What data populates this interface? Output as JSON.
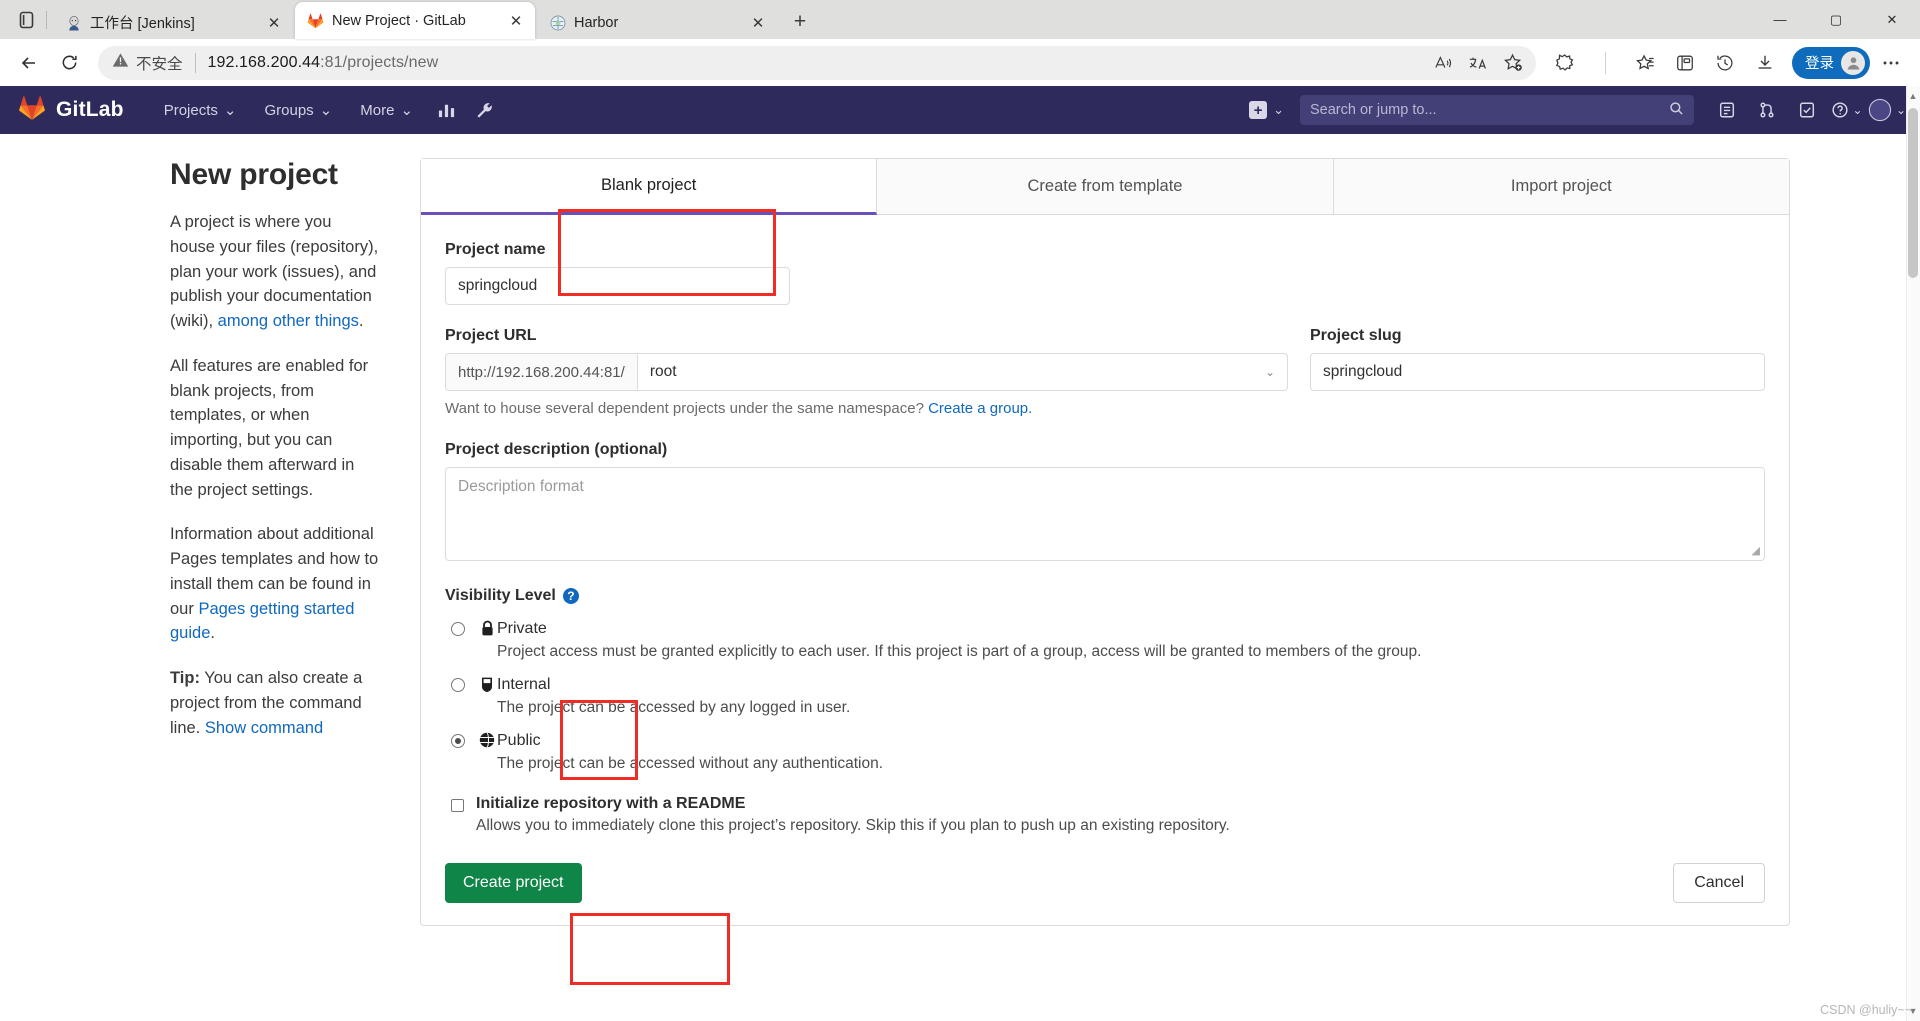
{
  "browser": {
    "tabs": [
      {
        "title": "工作台 [Jenkins]",
        "favicon": "jenkins-icon",
        "active": false
      },
      {
        "title": "New Project · GitLab",
        "favicon": "gitlab-icon",
        "active": true
      },
      {
        "title": "Harbor",
        "favicon": "harbor-icon",
        "active": false
      }
    ],
    "new_tab_label": "+",
    "tab_close_label": "✕",
    "window_controls": {
      "minimize": "—",
      "maximize": "▢",
      "close": "✕"
    },
    "toolbar": {
      "back_icon": "back-arrow-icon",
      "refresh_icon": "refresh-icon",
      "security_label": "不安全",
      "url_host": "192.168.200.44",
      "url_path": ":81/projects/new",
      "read_aloud_icon": "read-aloud-icon",
      "translate_icon": "translate-icon",
      "favorite_icon": "add-favorite-icon",
      "collections_icon": "collections-icon",
      "split_icon": "split-screen-icon",
      "history_icon": "history-icon",
      "downloads_icon": "downloads-icon",
      "settings_icon": "more-settings-icon",
      "signin_label": "登录"
    }
  },
  "gitlab": {
    "brand": "GitLab",
    "nav_links": [
      {
        "label": "Projects",
        "caret": "⌄"
      },
      {
        "label": "Groups",
        "caret": "⌄"
      },
      {
        "label": "More",
        "caret": "⌄"
      }
    ],
    "nav_icons": [
      "analytics-icon",
      "wrench-icon"
    ],
    "new_menu": {
      "plus": "+",
      "caret": "⌄"
    },
    "search": {
      "placeholder": "Search or jump to...",
      "icon": "search-icon"
    },
    "right_icons": [
      "issues-icon",
      "merge-requests-icon",
      "todos-icon",
      "help-icon",
      "avatar"
    ]
  },
  "sidebar": {
    "title": "New project",
    "paragraph1_pre": "A project is where you house your files (repository), plan your work (issues), and publish your documentation (wiki), ",
    "paragraph1_link": "among other things",
    "paragraph1_post": ".",
    "paragraph2": "All features are enabled for blank projects, from templates, or when importing, but you can disable them afterward in the project settings.",
    "paragraph3_pre": "Information about additional Pages templates and how to install them can be found in our ",
    "paragraph3_link": "Pages getting started guide",
    "paragraph3_post": ".",
    "tip_label": "Tip:",
    "tip_text": " You can also create a project from the command line. ",
    "tip_link": "Show command"
  },
  "form": {
    "tabs": [
      {
        "label": "Blank project",
        "active": true
      },
      {
        "label": "Create from template",
        "active": false
      },
      {
        "label": "Import project",
        "active": false
      }
    ],
    "project_name": {
      "label": "Project name",
      "value": "springcloud",
      "placeholder": ""
    },
    "project_url": {
      "label": "Project URL",
      "prefix": "http://192.168.200.44:81/",
      "namespace": "root",
      "caret": "⌄"
    },
    "project_slug": {
      "label": "Project slug",
      "value": "springcloud"
    },
    "namespace_hint_text": "Want to house several dependent projects under the same namespace? ",
    "namespace_hint_link": "Create a group.",
    "description": {
      "label": "Project description (optional)",
      "placeholder": "Description format"
    },
    "visibility": {
      "title": "Visibility Level",
      "help_icon": "question-mark-icon",
      "options": [
        {
          "name": "Private",
          "icon": "lock-icon",
          "checked": false,
          "desc": "Project access must be granted explicitly to each user. If this project is part of a group, access will be granted to members of the group."
        },
        {
          "name": "Internal",
          "icon": "shield-icon",
          "checked": false,
          "desc": "The project can be accessed by any logged in user."
        },
        {
          "name": "Public",
          "icon": "globe-icon",
          "checked": true,
          "desc": "The project can be accessed without any authentication."
        }
      ]
    },
    "readme": {
      "label": "Initialize repository with a README",
      "desc": "Allows you to immediately clone this project’s repository. Skip this if you plan to push up an existing repository.",
      "checked": false
    },
    "create_button": "Create project",
    "cancel_button": "Cancel"
  },
  "annotations": {
    "color": "#ef2d26"
  },
  "watermark": "CSDN @huliy~~"
}
